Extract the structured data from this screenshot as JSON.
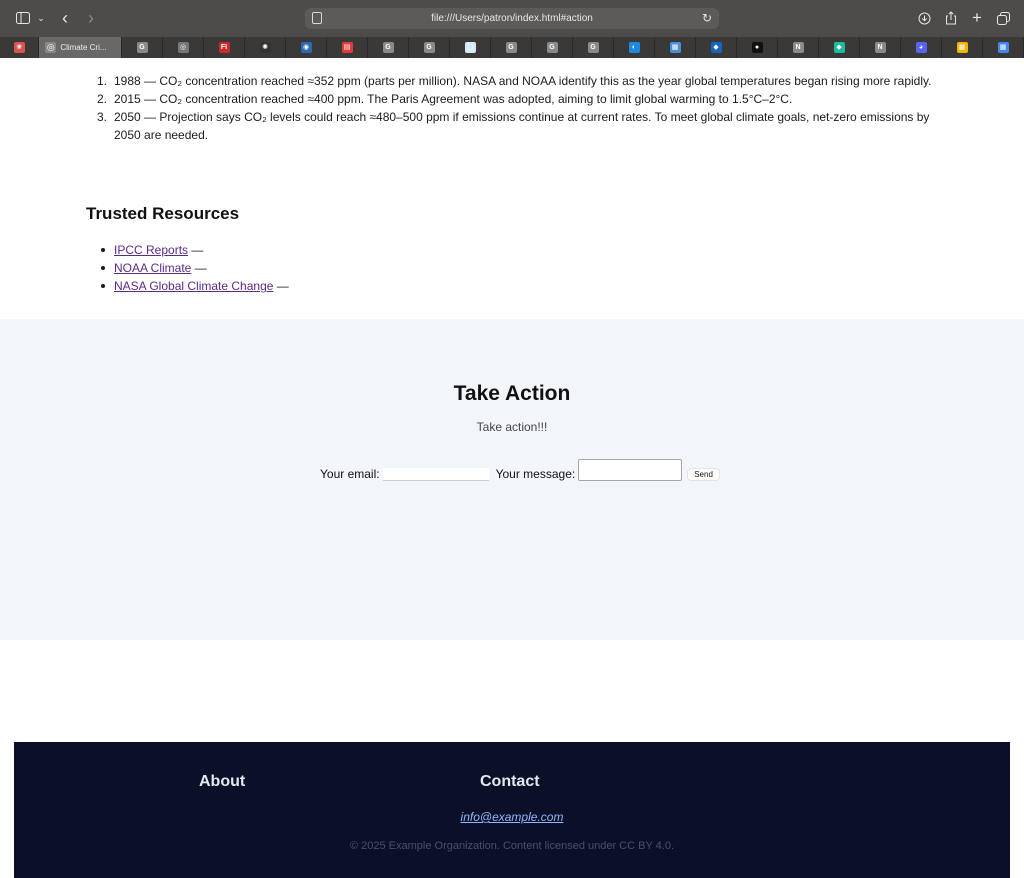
{
  "browser": {
    "url": "file:///Users/patron/index.html#action",
    "active_tab_title": "Climate Cri...",
    "tab_favicons": [
      {
        "icon": "flower-app-icon",
        "glyph": "❀",
        "color": "#d9534f"
      },
      {
        "icon": "google-g-icon",
        "glyph": "G",
        "color": "#8a8a8a"
      },
      {
        "icon": "compass-icon",
        "glyph": "◎",
        "color": "#777777"
      },
      {
        "icon": "fi-app-icon",
        "glyph": "FI",
        "color": "#cc2a2a"
      },
      {
        "icon": "openai-icon",
        "glyph": "✺",
        "color": "#333333"
      },
      {
        "icon": "noaa-icon",
        "glyph": "◉",
        "color": "#2b6cb0"
      },
      {
        "icon": "red-doc-icon",
        "glyph": "▤",
        "color": "#e03b3b"
      },
      {
        "icon": "google-g-icon",
        "glyph": "G",
        "color": "#8a8a8a"
      },
      {
        "icon": "google-g-icon",
        "glyph": "G",
        "color": "#8a8a8a"
      },
      {
        "icon": "light-app-icon",
        "glyph": "▢",
        "color": "#d5e9f7"
      },
      {
        "icon": "google-g-icon",
        "glyph": "G",
        "color": "#8a8a8a"
      },
      {
        "icon": "google-g-icon",
        "glyph": "G",
        "color": "#8a8a8a"
      },
      {
        "icon": "google-g-icon",
        "glyph": "G",
        "color": "#8a8a8a"
      },
      {
        "icon": "blue-circle-icon",
        "glyph": "◐",
        "color": "#1e88e5"
      },
      {
        "icon": "blue-square-icon",
        "glyph": "▦",
        "color": "#4a90d9"
      },
      {
        "icon": "noaa-bird-icon",
        "glyph": "◆",
        "color": "#1565c0"
      },
      {
        "icon": "github-icon",
        "glyph": "●",
        "color": "#111111"
      },
      {
        "icon": "notion-icon",
        "glyph": "N",
        "color": "#8a8a8a"
      },
      {
        "icon": "teal-diamond-icon",
        "glyph": "◆",
        "color": "#1abc9c"
      },
      {
        "icon": "notion-icon",
        "glyph": "N",
        "color": "#8a8a8a"
      },
      {
        "icon": "discord-icon",
        "glyph": "◕",
        "color": "#5865f2"
      },
      {
        "icon": "calendar-icon",
        "glyph": "▦",
        "color": "#f4b400"
      },
      {
        "icon": "calendar-icon",
        "glyph": "▦",
        "color": "#4285f4"
      }
    ]
  },
  "timeline": [
    {
      "num": "1.",
      "text": "1988 — CO₂ concentration reached ≈352 ppm (parts per million). NASA and NOAA identify this as the year global temperatures began rising more rapidly."
    },
    {
      "num": "2.",
      "text": "2015 — CO₂ concentration reached ≈400 ppm. The Paris Agreement was adopted, aiming to limit global warming to 1.5°C–2°C."
    },
    {
      "num": "3.",
      "text": "2050 — Projection says CO₂ levels could reach ≈480–500 ppm if emissions continue at current rates. To meet global climate goals, net-zero emissions by 2050 are needed."
    }
  ],
  "resources": {
    "title": "Trusted Resources",
    "items": [
      {
        "label": "IPCC Reports",
        "suffix": " —"
      },
      {
        "label": "NOAA Climate",
        "suffix": " —"
      },
      {
        "label": "NASA Global Climate Change",
        "suffix": " —"
      }
    ]
  },
  "action": {
    "title": "Take Action",
    "subtitle": "Take action!!!",
    "email_label": "Your email:",
    "message_label": "Your message:",
    "send_label": "Send"
  },
  "footer": {
    "about": "About",
    "contact": "Contact",
    "email": "info@example.com",
    "copyright": "© 2025 Example Organization. Content licensed under CC BY 4.0."
  }
}
